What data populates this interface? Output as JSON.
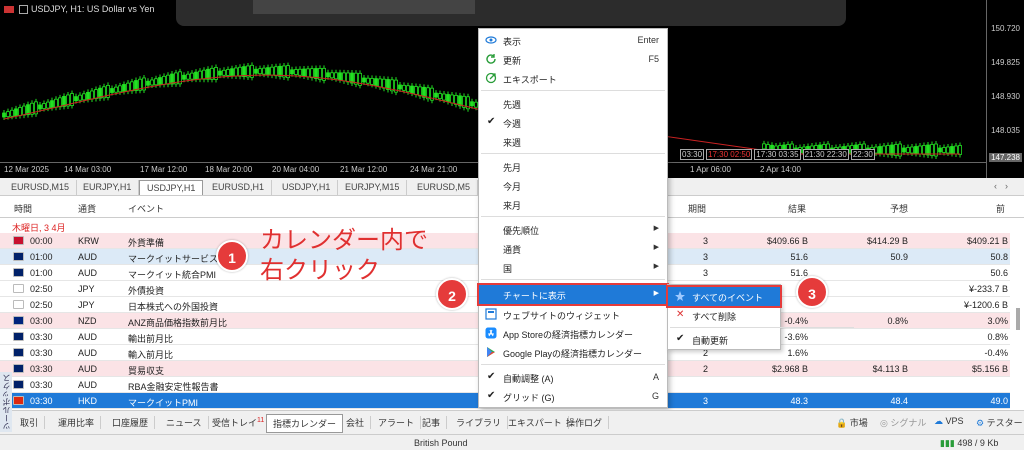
{
  "chart": {
    "symbol_title": "USDJPY, H1:  US Dollar vs Yen",
    "price_labels": [
      "150.720",
      "149.825",
      "148.930",
      "148.035"
    ],
    "price_tag": "147.238",
    "time_labels": [
      "12 Mar 2025",
      "14 Mar 03:00",
      "17 Mar 12:00",
      "18 Mar 20:00",
      "20 Mar 04:00",
      "21 Mar 12:00",
      "24 Mar 21:00",
      "1 Apr 06:00",
      "2 Apr 14:00"
    ],
    "event_marks": [
      "03:30",
      "17:30 02:50",
      "17:30 03:35",
      "21:30 22:30",
      "22:30"
    ]
  },
  "chart_tabs": [
    "EURUSD,M15",
    "EURJPY,H1",
    "USDJPY,H1",
    "EURUSD,H1",
    "USDJPY,H1",
    "EURJPY,M15",
    "EURUSD,M5"
  ],
  "calendar": {
    "headers": {
      "time": "時間",
      "currency": "通貨",
      "event": "イベント",
      "period": "期間",
      "actual": "結果",
      "forecast": "予想",
      "previous": "前"
    },
    "date_label": "木曜日, 3 4月",
    "rows": [
      {
        "time": "00:00",
        "currency": "KRW",
        "event": "外貨準備",
        "period": "3",
        "actual": "$409.66 B",
        "forecast": "$414.29 B",
        "previous": "$409.21 B",
        "style": "pink",
        "flag": "#c8102e"
      },
      {
        "time": "01:00",
        "currency": "AUD",
        "event": "マークイットサービス業景況",
        "period": "3",
        "actual": "51.6",
        "forecast": "50.9",
        "previous": "50.8",
        "style": "blue",
        "flag": "#012169"
      },
      {
        "time": "01:00",
        "currency": "AUD",
        "event": "マークイット統合PMI",
        "period": "3",
        "actual": "51.6",
        "forecast": "",
        "previous": "50.6",
        "style": "",
        "flag": "#012169"
      },
      {
        "time": "02:50",
        "currency": "JPY",
        "event": "外債投資",
        "period": "",
        "actual": "",
        "forecast": "",
        "previous": "¥-233.7 B",
        "style": "",
        "flag": "#ffffff"
      },
      {
        "time": "02:50",
        "currency": "JPY",
        "event": "日本株式への外国投資",
        "period": "",
        "actual": "",
        "forecast": "",
        "previous": "¥-1200.6 B",
        "style": "",
        "flag": "#ffffff"
      },
      {
        "time": "03:00",
        "currency": "NZD",
        "event": "ANZ商品価格指数前月比",
        "period": "",
        "actual": "-0.4%",
        "forecast": "0.8%",
        "previous": "3.0%",
        "style": "pink",
        "flag": "#00247d"
      },
      {
        "time": "03:30",
        "currency": "AUD",
        "event": "輸出前月比",
        "period": "",
        "actual": "-3.6%",
        "forecast": "",
        "previous": "0.8%",
        "style": "",
        "flag": "#012169"
      },
      {
        "time": "03:30",
        "currency": "AUD",
        "event": "輸入前月比",
        "period": "2",
        "actual": "1.6%",
        "forecast": "",
        "previous": "-0.4%",
        "style": "",
        "flag": "#012169"
      },
      {
        "time": "03:30",
        "currency": "AUD",
        "event": "貿易収支",
        "period": "2",
        "actual": "$2.968 B",
        "forecast": "$4.113 B",
        "previous": "$5.156 B",
        "style": "pink",
        "flag": "#012169"
      },
      {
        "time": "03:30",
        "currency": "AUD",
        "event": "RBA金融安定性報告書",
        "period": "",
        "actual": "",
        "forecast": "",
        "previous": "",
        "style": "",
        "flag": "#012169"
      },
      {
        "time": "03:30",
        "currency": "HKD",
        "event": "マークイットPMI",
        "period": "3",
        "actual": "48.3",
        "forecast": "48.4",
        "previous": "49.0",
        "style": "sel",
        "flag": "#de2910"
      }
    ]
  },
  "annotations": {
    "step1": "1",
    "step2": "2",
    "step3": "3",
    "instruction_line1": "カレンダー内で",
    "instruction_line2": "右クリック"
  },
  "context_menu": {
    "items": [
      {
        "label": "表示",
        "shortcut": "Enter",
        "icon": "eye-icon"
      },
      {
        "label": "更新",
        "shortcut": "F5",
        "icon": "refresh-icon"
      },
      {
        "label": "エキスポート",
        "shortcut": "",
        "icon": "export-icon"
      },
      {
        "label": "先週"
      },
      {
        "label": "今週",
        "checked": true
      },
      {
        "label": "来週"
      },
      {
        "label": "先月"
      },
      {
        "label": "今月"
      },
      {
        "label": "来月"
      },
      {
        "label": "優先順位"
      },
      {
        "label": "通貨"
      },
      {
        "label": "国"
      },
      {
        "label": "チャートに表示"
      },
      {
        "label": "ウェブサイトのウィジェット"
      },
      {
        "label": "App Storeの経済指標カレンダー"
      },
      {
        "label": "Google Playの経済指標カレンダー"
      },
      {
        "label": "自動調整 (A)",
        "shortcut": "A",
        "checked": true
      },
      {
        "label": "グリッド (G)",
        "shortcut": "G",
        "checked": true
      }
    ]
  },
  "submenu": {
    "items": [
      {
        "label": "すべてのイベント"
      },
      {
        "label": "すべて削除"
      },
      {
        "label": "自動更新"
      }
    ]
  },
  "bottom_tabs": [
    "取引",
    "運用比率",
    "口座履歴",
    "ニュース",
    "受信トレイ",
    "指標カレンダー",
    "会社",
    "アラート",
    "記事",
    "ライブラリ",
    "エキスパート",
    "操作ログ"
  ],
  "inbox_badge": "11",
  "toolbox_label": "ツールボックス",
  "right_tools": {
    "market": "市場",
    "signals": "シグナル",
    "vps": "VPS",
    "tester": "テスター"
  },
  "status": {
    "currency_name": "British Pound",
    "traffic": "498 / 9 Kb"
  },
  "colors": {
    "accent": "#1f7ad8",
    "annotation": "#e53b3b",
    "candle": "#22e022",
    "ma": "#cc2222"
  }
}
